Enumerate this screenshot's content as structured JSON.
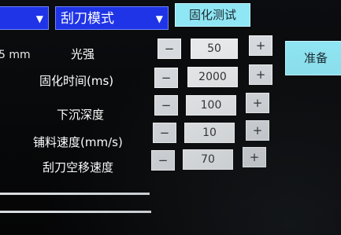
{
  "top": {
    "mode_dropdown": {
      "value": "刮刀模式"
    },
    "cure_test_button": "固化测试"
  },
  "left_edge": {
    "unit_text": "5 mm"
  },
  "prepare_button": "准备",
  "params": [
    {
      "label": "光强",
      "value": "50",
      "minus": "−",
      "plus": "+"
    },
    {
      "label": "固化时间(ms)",
      "value": "2000",
      "minus": "−",
      "plus": "+"
    },
    {
      "label": "下沉深度",
      "value": "100",
      "minus": "−",
      "plus": "+"
    },
    {
      "label": "铺料速度(mm/s)",
      "value": "10",
      "minus": "−",
      "plus": "+"
    },
    {
      "label": "刮刀空移速度",
      "value": "70",
      "minus": "−",
      "plus": "+"
    }
  ],
  "colors": {
    "dropdown_bg": "#1f34e6",
    "button_cyan": "#8fe6f4",
    "background": "#07080a"
  }
}
